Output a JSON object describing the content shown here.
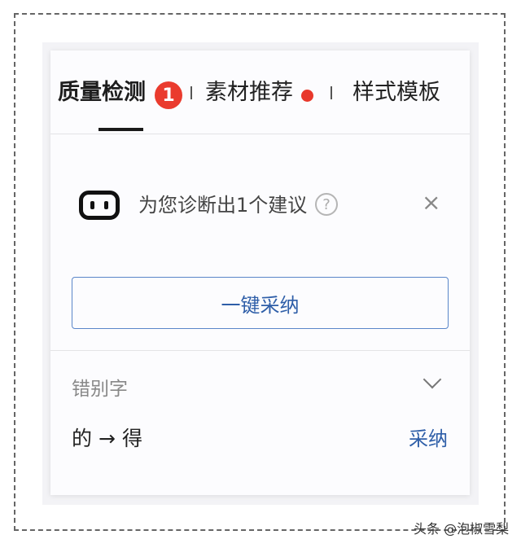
{
  "tabs": {
    "quality": "质量检测",
    "quality_badge": "1",
    "materials": "素材推荐",
    "templates": "样式模板"
  },
  "diagnosis": {
    "message": "为您诊断出1个建议",
    "help_symbol": "?",
    "close_symbol": "×"
  },
  "actions": {
    "adopt_all": "一键采纳"
  },
  "category": {
    "label": "错别字"
  },
  "suggestion": {
    "original": "的",
    "arrow": "→",
    "replacement": "得",
    "adopt": "采纳"
  },
  "watermark": "头条 @泡椒雪梨",
  "colors": {
    "accent": "#2e5ea8",
    "badge": "#ea3b2e",
    "dot": "#e8382b"
  }
}
